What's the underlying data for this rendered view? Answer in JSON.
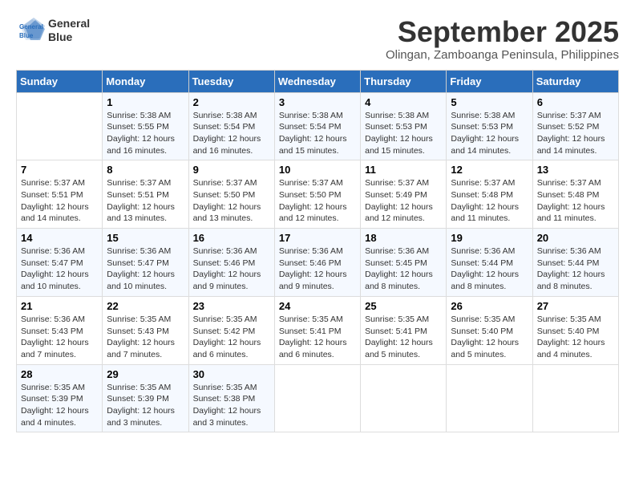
{
  "header": {
    "logo_line1": "General",
    "logo_line2": "Blue",
    "month": "September 2025",
    "location": "Olingan, Zamboanga Peninsula, Philippines"
  },
  "days_of_week": [
    "Sunday",
    "Monday",
    "Tuesday",
    "Wednesday",
    "Thursday",
    "Friday",
    "Saturday"
  ],
  "weeks": [
    [
      {
        "num": "",
        "info": ""
      },
      {
        "num": "1",
        "info": "Sunrise: 5:38 AM\nSunset: 5:55 PM\nDaylight: 12 hours\nand 16 minutes."
      },
      {
        "num": "2",
        "info": "Sunrise: 5:38 AM\nSunset: 5:54 PM\nDaylight: 12 hours\nand 16 minutes."
      },
      {
        "num": "3",
        "info": "Sunrise: 5:38 AM\nSunset: 5:54 PM\nDaylight: 12 hours\nand 15 minutes."
      },
      {
        "num": "4",
        "info": "Sunrise: 5:38 AM\nSunset: 5:53 PM\nDaylight: 12 hours\nand 15 minutes."
      },
      {
        "num": "5",
        "info": "Sunrise: 5:38 AM\nSunset: 5:53 PM\nDaylight: 12 hours\nand 14 minutes."
      },
      {
        "num": "6",
        "info": "Sunrise: 5:37 AM\nSunset: 5:52 PM\nDaylight: 12 hours\nand 14 minutes."
      }
    ],
    [
      {
        "num": "7",
        "info": "Sunrise: 5:37 AM\nSunset: 5:51 PM\nDaylight: 12 hours\nand 14 minutes."
      },
      {
        "num": "8",
        "info": "Sunrise: 5:37 AM\nSunset: 5:51 PM\nDaylight: 12 hours\nand 13 minutes."
      },
      {
        "num": "9",
        "info": "Sunrise: 5:37 AM\nSunset: 5:50 PM\nDaylight: 12 hours\nand 13 minutes."
      },
      {
        "num": "10",
        "info": "Sunrise: 5:37 AM\nSunset: 5:50 PM\nDaylight: 12 hours\nand 12 minutes."
      },
      {
        "num": "11",
        "info": "Sunrise: 5:37 AM\nSunset: 5:49 PM\nDaylight: 12 hours\nand 12 minutes."
      },
      {
        "num": "12",
        "info": "Sunrise: 5:37 AM\nSunset: 5:48 PM\nDaylight: 12 hours\nand 11 minutes."
      },
      {
        "num": "13",
        "info": "Sunrise: 5:37 AM\nSunset: 5:48 PM\nDaylight: 12 hours\nand 11 minutes."
      }
    ],
    [
      {
        "num": "14",
        "info": "Sunrise: 5:36 AM\nSunset: 5:47 PM\nDaylight: 12 hours\nand 10 minutes."
      },
      {
        "num": "15",
        "info": "Sunrise: 5:36 AM\nSunset: 5:47 PM\nDaylight: 12 hours\nand 10 minutes."
      },
      {
        "num": "16",
        "info": "Sunrise: 5:36 AM\nSunset: 5:46 PM\nDaylight: 12 hours\nand 9 minutes."
      },
      {
        "num": "17",
        "info": "Sunrise: 5:36 AM\nSunset: 5:46 PM\nDaylight: 12 hours\nand 9 minutes."
      },
      {
        "num": "18",
        "info": "Sunrise: 5:36 AM\nSunset: 5:45 PM\nDaylight: 12 hours\nand 8 minutes."
      },
      {
        "num": "19",
        "info": "Sunrise: 5:36 AM\nSunset: 5:44 PM\nDaylight: 12 hours\nand 8 minutes."
      },
      {
        "num": "20",
        "info": "Sunrise: 5:36 AM\nSunset: 5:44 PM\nDaylight: 12 hours\nand 8 minutes."
      }
    ],
    [
      {
        "num": "21",
        "info": "Sunrise: 5:36 AM\nSunset: 5:43 PM\nDaylight: 12 hours\nand 7 minutes."
      },
      {
        "num": "22",
        "info": "Sunrise: 5:35 AM\nSunset: 5:43 PM\nDaylight: 12 hours\nand 7 minutes."
      },
      {
        "num": "23",
        "info": "Sunrise: 5:35 AM\nSunset: 5:42 PM\nDaylight: 12 hours\nand 6 minutes."
      },
      {
        "num": "24",
        "info": "Sunrise: 5:35 AM\nSunset: 5:41 PM\nDaylight: 12 hours\nand 6 minutes."
      },
      {
        "num": "25",
        "info": "Sunrise: 5:35 AM\nSunset: 5:41 PM\nDaylight: 12 hours\nand 5 minutes."
      },
      {
        "num": "26",
        "info": "Sunrise: 5:35 AM\nSunset: 5:40 PM\nDaylight: 12 hours\nand 5 minutes."
      },
      {
        "num": "27",
        "info": "Sunrise: 5:35 AM\nSunset: 5:40 PM\nDaylight: 12 hours\nand 4 minutes."
      }
    ],
    [
      {
        "num": "28",
        "info": "Sunrise: 5:35 AM\nSunset: 5:39 PM\nDaylight: 12 hours\nand 4 minutes."
      },
      {
        "num": "29",
        "info": "Sunrise: 5:35 AM\nSunset: 5:39 PM\nDaylight: 12 hours\nand 3 minutes."
      },
      {
        "num": "30",
        "info": "Sunrise: 5:35 AM\nSunset: 5:38 PM\nDaylight: 12 hours\nand 3 minutes."
      },
      {
        "num": "",
        "info": ""
      },
      {
        "num": "",
        "info": ""
      },
      {
        "num": "",
        "info": ""
      },
      {
        "num": "",
        "info": ""
      }
    ]
  ]
}
